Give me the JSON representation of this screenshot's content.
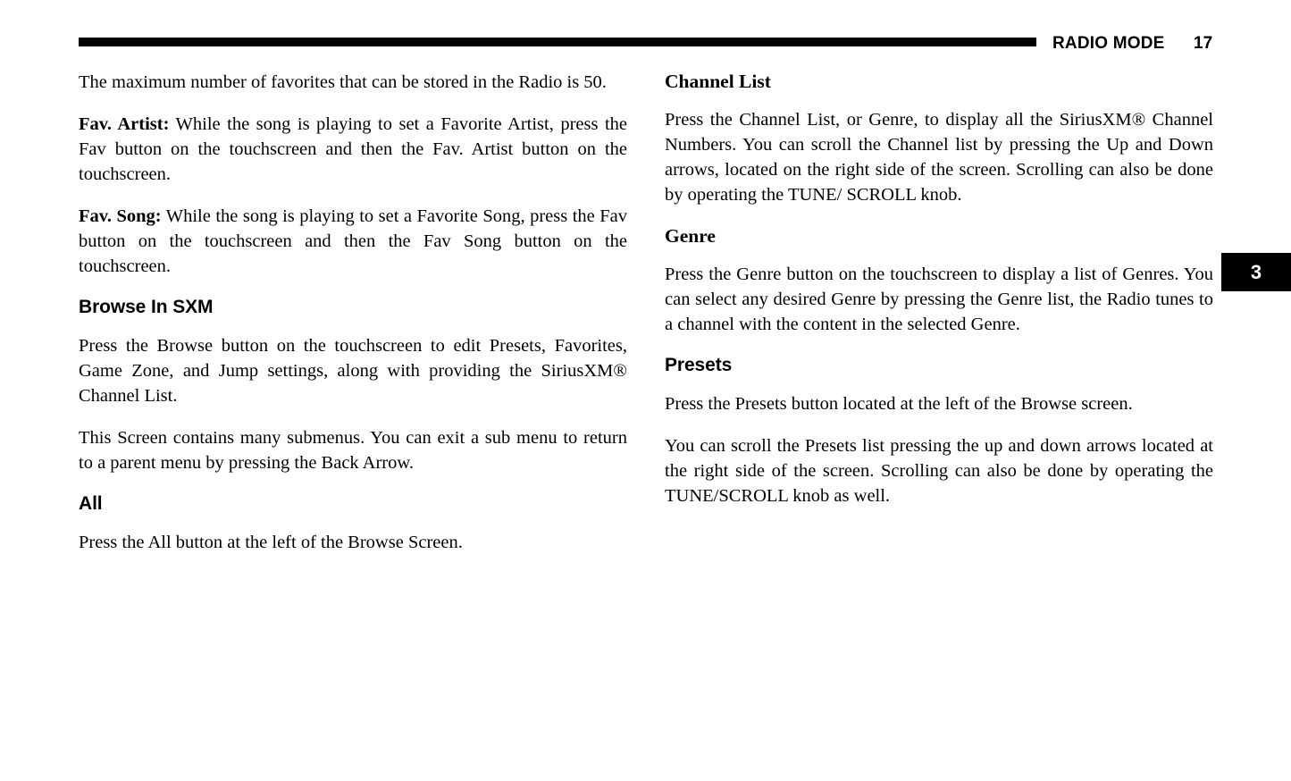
{
  "header": {
    "section_title": "RADIO MODE",
    "page_number": "17"
  },
  "chapter_tab": {
    "number": "3",
    "background_color": "#000000",
    "text_color": "#ffffff"
  },
  "left_column": {
    "blocks": [
      {
        "type": "paragraph",
        "text": "The maximum number of favorites that can be stored in the Radio is 50."
      },
      {
        "type": "paragraph",
        "lead_in": "Fav. Artist:",
        "text": " While the song is playing to set a Favorite Artist, press the Fav button on the touchscreen and then the Fav. Artist button on the touchscreen."
      },
      {
        "type": "paragraph",
        "lead_in": "Fav. Song:",
        "text": " While the song is playing to set a Favorite Song, press the Fav button on the touchscreen and then the Fav Song button on the touchscreen."
      },
      {
        "type": "heading",
        "style": "sans",
        "text": "Browse In SXM"
      },
      {
        "type": "paragraph",
        "text": "Press the Browse button on the touchscreen to edit Presets, Favorites, Game Zone, and Jump settings, along with providing the SiriusXM® Channel List."
      },
      {
        "type": "paragraph",
        "text": "This Screen contains many submenus. You can exit a sub menu to return to a parent menu by pressing the Back Arrow."
      },
      {
        "type": "heading",
        "style": "sans",
        "text": "All"
      },
      {
        "type": "paragraph",
        "text": "Press the All button at the left of the Browse Screen."
      }
    ]
  },
  "right_column": {
    "blocks": [
      {
        "type": "heading",
        "style": "serif",
        "text": "Channel List"
      },
      {
        "type": "paragraph",
        "text": "Press the Channel List, or Genre, to display all the SiriusXM® Channel Numbers. You can scroll the Channel list by pressing the Up and Down arrows, located on the right side of the screen. Scrolling can also be done by operating the TUNE/ SCROLL knob."
      },
      {
        "type": "heading",
        "style": "serif",
        "text": "Genre"
      },
      {
        "type": "paragraph",
        "text": "Press the Genre button on the touchscreen to display a list of Genres. You can select any desired Genre by pressing the Genre list, the Radio tunes to a channel with the content in the selected Genre."
      },
      {
        "type": "heading",
        "style": "sans",
        "text": "Presets"
      },
      {
        "type": "paragraph",
        "text": "Press the Presets button located at the left of the Browse screen."
      },
      {
        "type": "paragraph",
        "text": "You can scroll the Presets list pressing the up and down arrows located at the right side of the screen. Scrolling can also be done by operating the TUNE/SCROLL knob as well."
      }
    ]
  }
}
